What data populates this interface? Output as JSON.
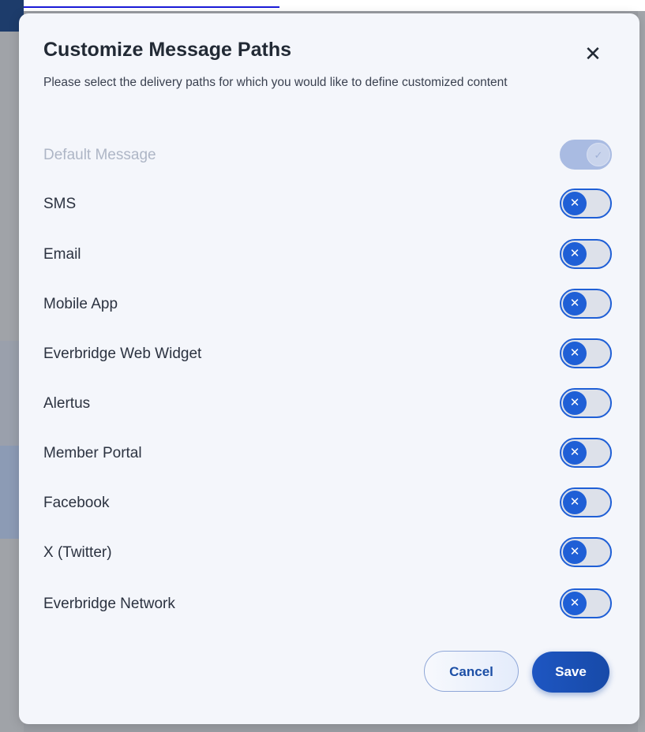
{
  "modal": {
    "title": "Customize Message Paths",
    "close_icon": "close-icon",
    "subtitle": "Please select the delivery paths for which you would like to define customized content",
    "paths": [
      {
        "label": "Default Message",
        "state": "on",
        "disabled": true
      },
      {
        "label": "SMS",
        "state": "off",
        "disabled": false
      },
      {
        "label": "Email",
        "state": "off",
        "disabled": false
      },
      {
        "label": "Mobile App",
        "state": "off",
        "disabled": false
      },
      {
        "label": "Everbridge Web Widget",
        "state": "off",
        "disabled": false
      },
      {
        "label": "Alertus",
        "state": "off",
        "disabled": false
      },
      {
        "label": "Member Portal",
        "state": "off",
        "disabled": false
      },
      {
        "label": "Facebook",
        "state": "off",
        "disabled": false
      },
      {
        "label": "X (Twitter)",
        "state": "off",
        "disabled": false
      },
      {
        "label": "Everbridge Network",
        "state": "off",
        "disabled": false
      }
    ],
    "cancel_label": "Cancel",
    "save_label": "Save"
  },
  "colors": {
    "accent": "#1f5fd6",
    "save_button": "#1a4fb2",
    "modal_bg": "#f4f6fb",
    "overlay": "#9a9da3"
  }
}
